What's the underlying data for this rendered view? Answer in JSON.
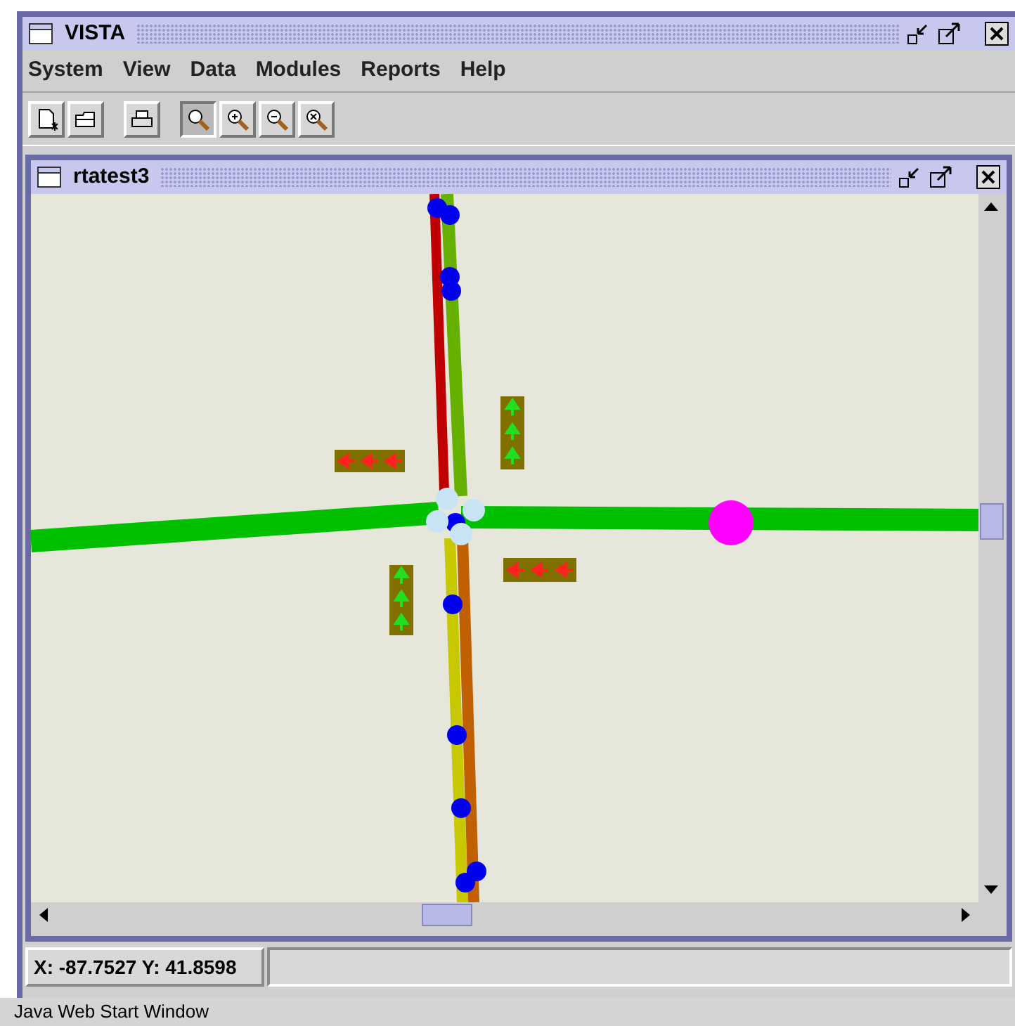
{
  "window": {
    "title": "VISTA"
  },
  "menu": [
    {
      "label": "System"
    },
    {
      "label": "View"
    },
    {
      "label": "Data"
    },
    {
      "label": "Modules"
    },
    {
      "label": "Reports"
    },
    {
      "label": "Help"
    }
  ],
  "toolbar": [
    {
      "kind": "new",
      "selected": false
    },
    {
      "kind": "open",
      "selected": false
    },
    {
      "kind": "gap"
    },
    {
      "kind": "print",
      "selected": false
    },
    {
      "kind": "gap"
    },
    {
      "kind": "zoom",
      "selected": true
    },
    {
      "kind": "zoom-in",
      "selected": false
    },
    {
      "kind": "zoom-out",
      "selected": false
    },
    {
      "kind": "zoom-reset",
      "selected": false
    }
  ],
  "inner_window": {
    "title": "rtatest3"
  },
  "status_bar": {
    "coordinates": "X: -87.7527 Y: 41.8598"
  },
  "footer": "Java Web Start Window"
}
